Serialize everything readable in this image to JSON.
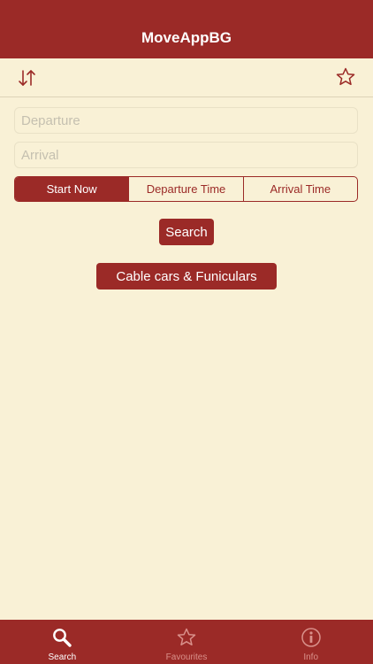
{
  "app": {
    "title": "MoveAppBG"
  },
  "toolbar": {
    "swap_icon": "swap-arrows-icon",
    "favourite_icon": "star-outline-icon"
  },
  "form": {
    "departure": {
      "value": "",
      "placeholder": "Departure"
    },
    "arrival": {
      "value": "",
      "placeholder": "Arrival"
    },
    "time_modes": [
      {
        "label": "Start Now",
        "selected": true
      },
      {
        "label": "Departure Time",
        "selected": false
      },
      {
        "label": "Arrival Time",
        "selected": false
      }
    ],
    "search_label": "Search",
    "cable_label": "Cable cars & Funiculars"
  },
  "tabs": [
    {
      "label": "Search",
      "icon": "magnifier-icon",
      "selected": true
    },
    {
      "label": "Favourites",
      "icon": "star-icon",
      "selected": false
    },
    {
      "label": "Info",
      "icon": "info-icon",
      "selected": false
    }
  ],
  "colors": {
    "brand": "#9b2a27",
    "background": "#f9f1d6",
    "tab_inactive": "#d9908a",
    "placeholder": "#c5c0b0"
  }
}
